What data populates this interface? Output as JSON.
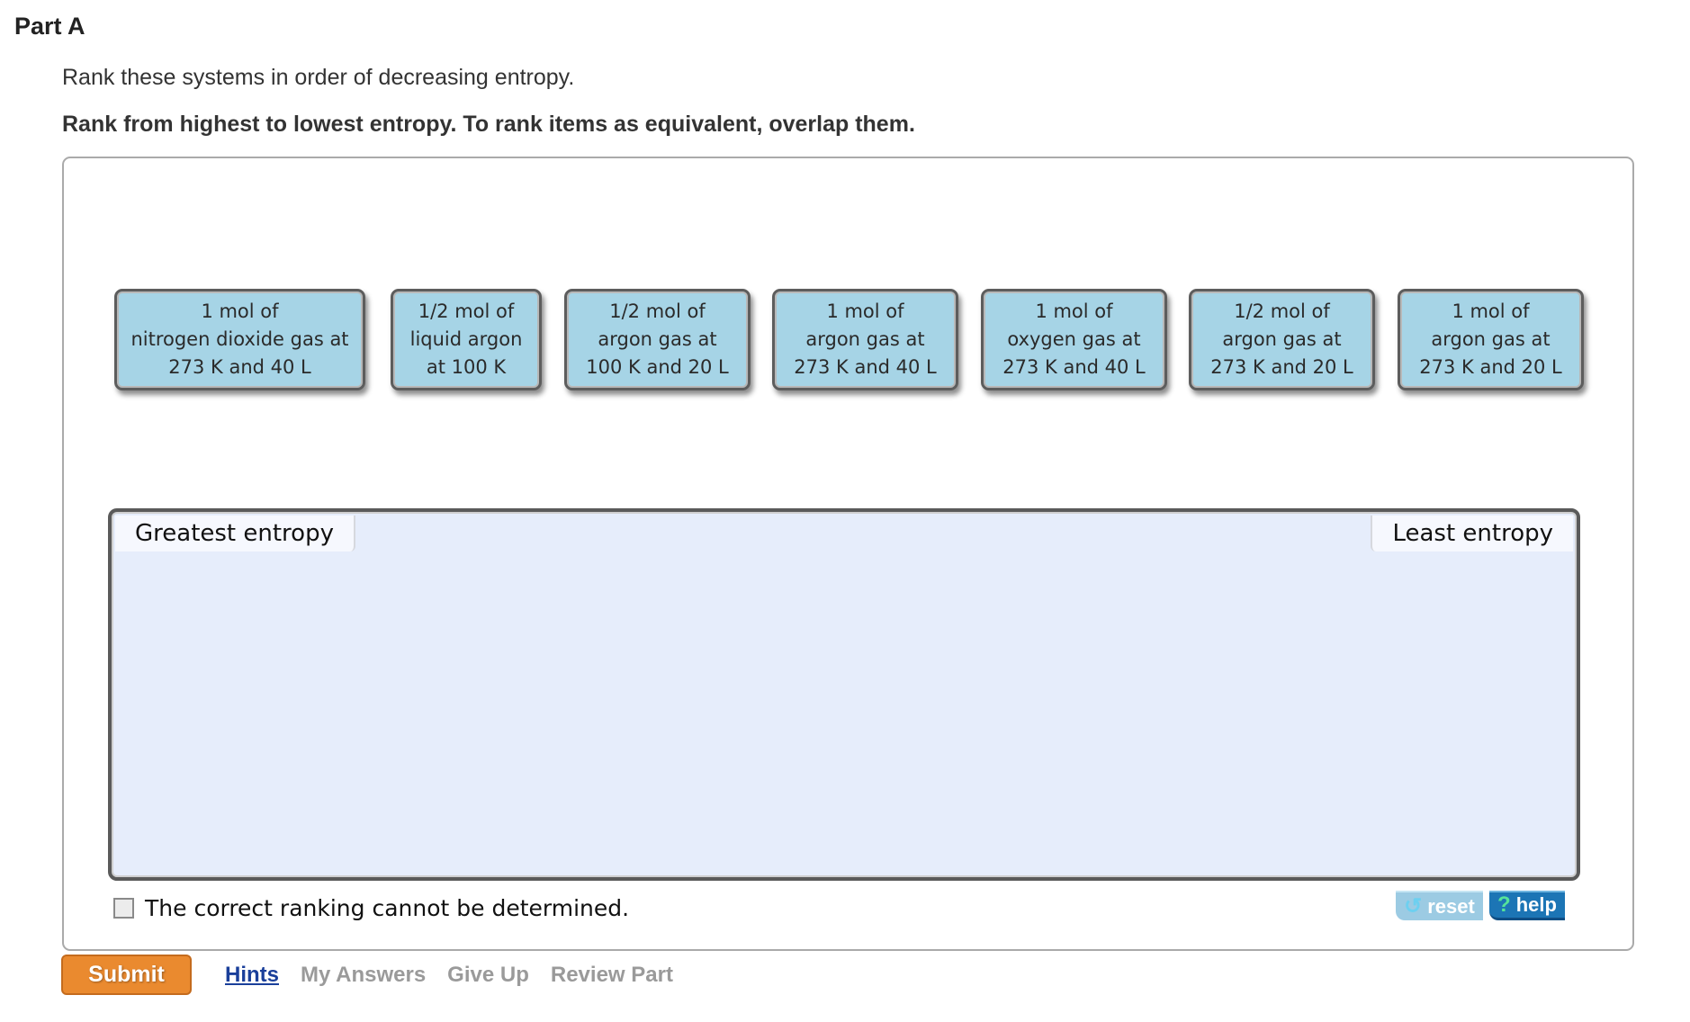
{
  "part": {
    "title": "Part A",
    "instructions": "Rank these systems in order of decreasing entropy.",
    "rank_note": "Rank from highest to lowest entropy. To rank items as equivalent, overlap them."
  },
  "items": [
    {
      "lines": [
        "1 mol of",
        "nitrogen dioxide gas at",
        "273 K and 40 L"
      ]
    },
    {
      "lines": [
        "1/2 mol of",
        "liquid argon",
        "at 100 K"
      ]
    },
    {
      "lines": [
        "1/2 mol of",
        "argon gas at",
        "100 K and 20 L"
      ]
    },
    {
      "lines": [
        "1 mol of",
        "argon gas at",
        "273 K and 40 L"
      ]
    },
    {
      "lines": [
        "1 mol of",
        "oxygen gas at",
        "273 K and 40 L"
      ]
    },
    {
      "lines": [
        "1/2 mol of",
        "argon gas at",
        "273 K and 20 L"
      ]
    },
    {
      "lines": [
        "1 mol of",
        "argon gas at",
        "273 K and 20 L"
      ]
    }
  ],
  "ranking": {
    "left_label": "Greatest entropy",
    "right_label": "Least entropy"
  },
  "cannot_determine": {
    "label": "The correct ranking cannot be determined.",
    "checked": false
  },
  "tools": {
    "reset_label": "reset",
    "reset_icon": "↺",
    "help_label": "help",
    "help_icon": "?"
  },
  "footer": {
    "submit_label": "Submit",
    "links": [
      {
        "label": "Hints",
        "enabled": true
      },
      {
        "label": "My Answers",
        "enabled": false
      },
      {
        "label": "Give Up",
        "enabled": false
      },
      {
        "label": "Review Part",
        "enabled": false
      }
    ]
  }
}
